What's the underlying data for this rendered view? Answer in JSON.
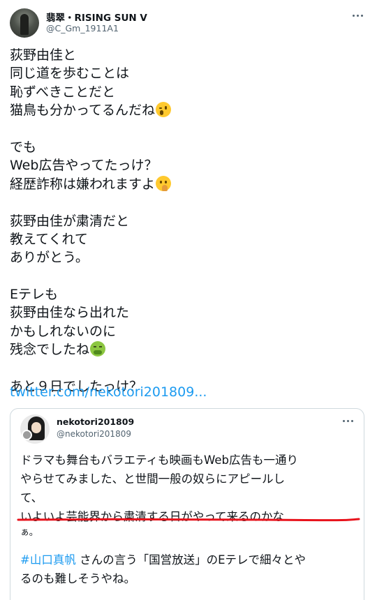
{
  "tweet": {
    "author_name": "翡翠・RISING SUN V",
    "author_handle": "@C_Gm_1911A1",
    "body_lines": [
      "荻野由佳と",
      "同じ道を歩むことは",
      "恥ずべきことだと",
      "猫鳥も分かってるんだね",
      "",
      "でも",
      "Web広告やってたっけ？",
      "経歴詐称は嫌われますよ",
      "",
      "荻野由佳が粛清だと",
      "教えてくれて",
      "ありがとう。",
      "",
      "Eテレも",
      "荻野由佳なら出れた",
      "かもしれないのに",
      "残念でしたね",
      "",
      "あと９日でしたっけ？"
    ],
    "link_text": "twitter.com/nekotori201809..."
  },
  "quote": {
    "author_name": "nekotori201809",
    "author_handle": "@nekotori201809",
    "lines": [
      "ドラマも舞台もバラエティも映画もWeb広告も一通り",
      "やらせてみました、と世間一般の奴らにアピールし",
      "て、",
      "いよいよ芸能界から粛清する日がやって来るのかな",
      "ぁ。"
    ],
    "hashtag": "#山口真帆",
    "after_hashtag": " さんの言う「国営放送」のEテレで細々とや",
    "last_line": "るのも難しそうやね。"
  },
  "icons": {
    "more": "more-horizontal-icon",
    "emoji_wink": "winking-face-emoji",
    "emoji_thinking": "thinking-face-emoji",
    "emoji_nauseated": "nauseated-face-emoji"
  },
  "colors": {
    "link": "#1d9bf0",
    "underline_mark": "#e8121b",
    "secondary_text": "#536471",
    "border": "#cfd9de"
  }
}
